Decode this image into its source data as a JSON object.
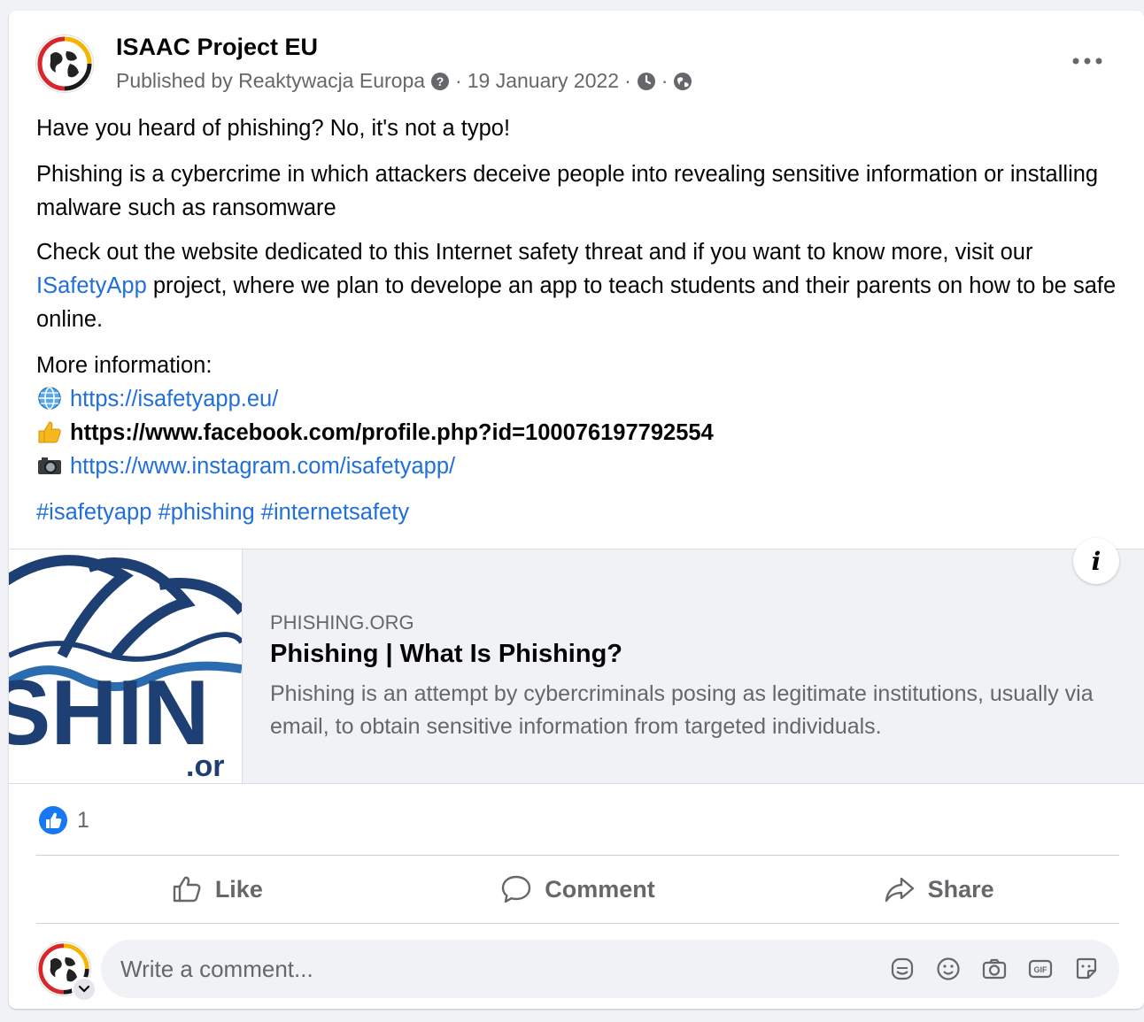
{
  "post": {
    "page_name": "ISAAC Project EU",
    "published_prefix": "Published by Reaktywacja Europa",
    "date": "19 January 2022",
    "sep": "·"
  },
  "content": {
    "p1": "Have you heard of phishing? No, it's not a typo!",
    "p2": "Phishing is a cybercrime in which attackers deceive people into revealing sensitive information or installing malware such as ransomware",
    "p3_before": "Check out the website dedicated to this Internet safety threat and if you want to know more, visit our ",
    "p3_link": "ISafetyApp",
    "p3_after": " project, where we plan to develope an app to teach students and their parents on how to be safe online.",
    "more_info": "More information:",
    "link_web": "https://isafetyapp.eu/",
    "link_fb": "https://www.facebook.com/profile.php?id=100076197792554",
    "link_ig": "https://www.instagram.com/isafetyapp/",
    "hashtags": [
      "#isafetyapp",
      "#phishing",
      "#internetsafety"
    ]
  },
  "preview": {
    "domain": "PHISHING.ORG",
    "title": "Phishing | What Is Phishing?",
    "description": "Phishing is an attempt by cybercriminals posing as legitimate institutions, usually via email, to obtain sensitive information from targeted individuals.",
    "thumb_text": "SHIN",
    "thumb_sub": ".or",
    "info_glyph": "i"
  },
  "reactions": {
    "count": "1"
  },
  "actions": {
    "like": "Like",
    "comment": "Comment",
    "share": "Share"
  },
  "comment_box": {
    "placeholder": "Write a comment..."
  },
  "colors": {
    "link": "#216fdb",
    "like_blue": "#1877f2",
    "muted": "#65676b"
  },
  "icons": [
    "more-icon",
    "help-icon",
    "clock-icon",
    "globe-icon",
    "like-icon",
    "comment-icon",
    "share-icon",
    "sticker-icon",
    "emoji-icon",
    "camera-icon",
    "gif-icon",
    "avatar-sticker-icon"
  ]
}
